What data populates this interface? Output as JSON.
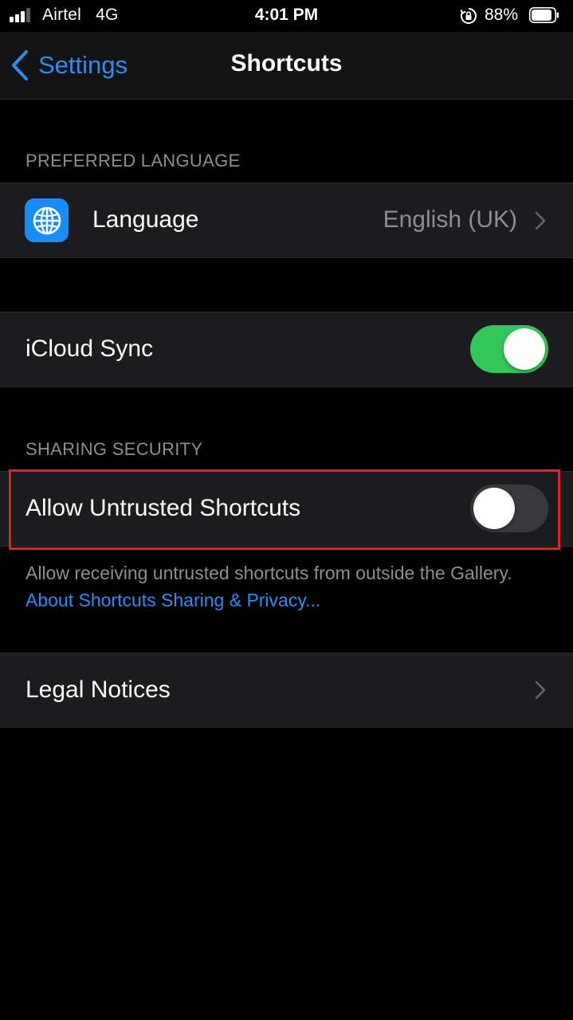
{
  "status_bar": {
    "carrier": "Airtel",
    "network": "4G",
    "time": "4:01 PM",
    "battery_percent": "88%",
    "battery_level": 0.88,
    "signal_bars": 3,
    "icons": [
      "signal-icon",
      "rotation-lock-icon",
      "battery-icon"
    ]
  },
  "nav": {
    "back_label": "Settings",
    "title": "Shortcuts"
  },
  "sections": {
    "preferred_language": {
      "header": "PREFERRED LANGUAGE",
      "language_label": "Language",
      "language_value": "English (UK)"
    },
    "icloud": {
      "label": "iCloud Sync",
      "enabled": true
    },
    "sharing_security": {
      "header": "SHARING SECURITY",
      "allow_untrusted_label": "Allow Untrusted Shortcuts",
      "allow_untrusted_enabled": false,
      "footer_text": "Allow receiving untrusted shortcuts from outside the Gallery.",
      "footer_link": "About Shortcuts Sharing & Privacy..."
    },
    "legal": {
      "label": "Legal Notices"
    }
  },
  "colors": {
    "accent": "#2d8cf0",
    "toggle_on": "#33c759",
    "toggle_off": "#39393d",
    "highlight": "#e0202a",
    "icon_bg": "#1a8cff"
  }
}
